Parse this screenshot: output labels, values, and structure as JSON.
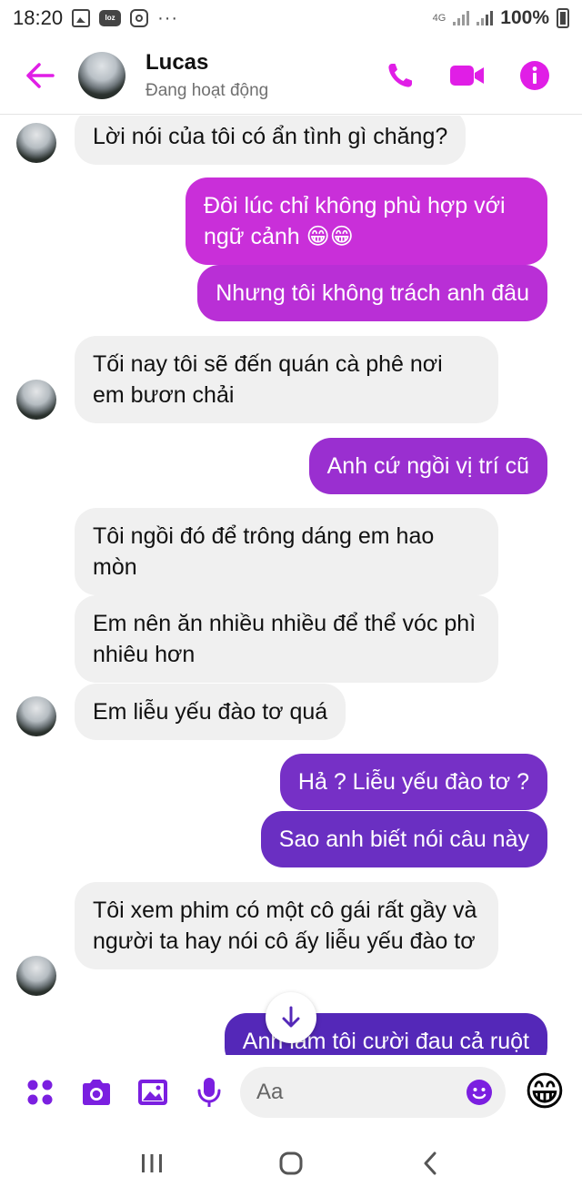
{
  "status_bar": {
    "time": "18:20",
    "dots": "···",
    "loz_label": "loz",
    "network": "4G",
    "battery": "100%"
  },
  "header": {
    "contact_name": "Lucas",
    "contact_status": "Đang hoạt động",
    "accent_color": "#e01ee6"
  },
  "messages": [
    {
      "from": "them",
      "text": "Lời nói của tôi có ẩn tình gì chăng?"
    },
    {
      "from": "me",
      "text": "Đôi lúc chỉ không phù hợp với ngữ cảnh 😁😁",
      "color": "#c92fd9"
    },
    {
      "from": "me",
      "text": "Nhưng tôi không trách anh đâu",
      "color": "#b92fd6"
    },
    {
      "from": "them",
      "text": "Tối nay tôi sẽ đến quán cà phê nơi em bươn chải"
    },
    {
      "from": "me",
      "text": "Anh cứ ngồi vị trí cũ",
      "color": "#9a2fd0"
    },
    {
      "from": "them",
      "text": "Tôi ngồi đó để trông dáng em hao mòn"
    },
    {
      "from": "them",
      "text": "Em nên ăn nhiều nhiều để thể vóc phì nhiêu hơn"
    },
    {
      "from": "them",
      "text": "Em liễu yếu đào tơ quá"
    },
    {
      "from": "me",
      "text": "Hả ? Liễu yếu đào tơ ?",
      "color": "#7630c6"
    },
    {
      "from": "me",
      "text": "Sao anh biết nói câu này",
      "color": "#6a2fc2"
    },
    {
      "from": "them",
      "text": "Tôi xem phim có một cô gái rất gầy và người ta hay nói cô ấy  liễu yếu đào tơ"
    },
    {
      "from": "me",
      "text": "Anh làm tôi cười đau cả ruột",
      "color": "#5428b8"
    }
  ],
  "composer": {
    "placeholder": "Aa",
    "quick_reaction": "😁",
    "accent_color": "#7b1fe0"
  }
}
